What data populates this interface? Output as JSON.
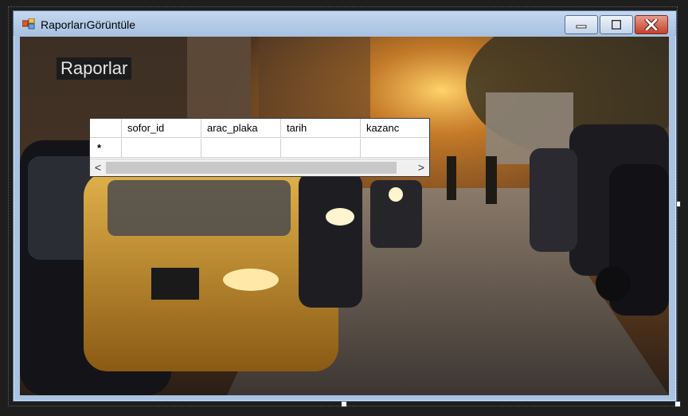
{
  "window": {
    "title": "RaporlarıGörüntüle",
    "controls": {
      "minimize": "minimize",
      "maximize": "maximize",
      "close": "close"
    }
  },
  "form": {
    "heading": "Raporlar",
    "grid": {
      "columns": [
        "sofor_id",
        "arac_plaka",
        "tarih",
        "kazanc"
      ],
      "new_row_marker": "*",
      "scroll_left": "<",
      "scroll_right": ">"
    }
  },
  "colors": {
    "title_gradient_top": "#c4d7ee",
    "close_button": "#c3402a",
    "label_background": "#1c1c1c"
  }
}
